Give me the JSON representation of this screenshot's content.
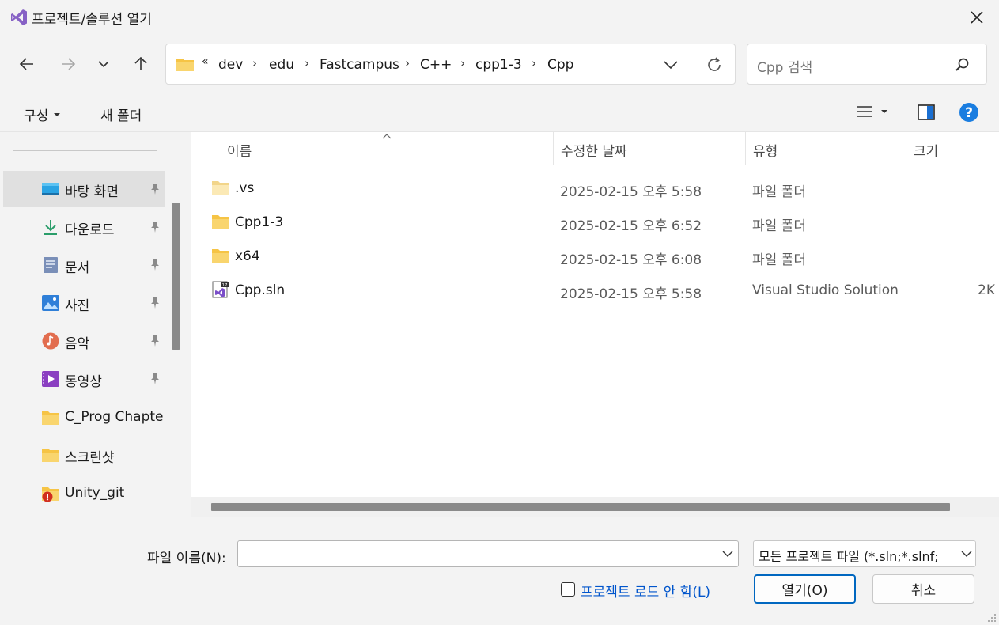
{
  "title": "프로젝트/솔루션 열기",
  "nav": {
    "breadcrumb_overflow": "«",
    "breadcrumb": [
      "dev",
      "edu",
      "Fastcampus",
      "C++",
      "cpp1-3",
      "Cpp"
    ],
    "search_placeholder": "Cpp 검색"
  },
  "toolbar": {
    "organize_label": "구성",
    "new_folder_label": "새 폴더"
  },
  "sidebar": {
    "items": [
      {
        "label": "바탕 화면",
        "icon": "desktop-icon",
        "pinned": true
      },
      {
        "label": "다운로드",
        "icon": "download-icon",
        "pinned": true
      },
      {
        "label": "문서",
        "icon": "document-icon",
        "pinned": true
      },
      {
        "label": "사진",
        "icon": "pictures-icon",
        "pinned": true
      },
      {
        "label": "음악",
        "icon": "music-icon",
        "pinned": true
      },
      {
        "label": "동영상",
        "icon": "video-icon",
        "pinned": true
      },
      {
        "label": "C_Prog Chapter_",
        "icon": "folder-icon",
        "pinned": false
      },
      {
        "label": "스크린샷",
        "icon": "folder-icon",
        "pinned": false
      },
      {
        "label": "Unity_git",
        "icon": "folder-warning-icon",
        "pinned": false
      }
    ]
  },
  "columns": {
    "name": "이름",
    "date": "수정한 날짜",
    "type": "유형",
    "size": "크기"
  },
  "files": [
    {
      "name": ".vs",
      "date": "2025-02-15 오후 5:58",
      "type": "파일 폴더",
      "size": "",
      "icon": "folder-icon"
    },
    {
      "name": "Cpp1-3",
      "date": "2025-02-15 오후 6:52",
      "type": "파일 폴더",
      "size": "",
      "icon": "folder-icon"
    },
    {
      "name": "x64",
      "date": "2025-02-15 오후 6:08",
      "type": "파일 폴더",
      "size": "",
      "icon": "folder-icon"
    },
    {
      "name": "Cpp.sln",
      "date": "2025-02-15 오후 5:58",
      "type": "Visual Studio Solution",
      "size": "2K",
      "icon": "vs-solution-icon"
    }
  ],
  "bottom": {
    "filename_label": "파일 이름(N):",
    "filename_value": "",
    "filter_value": "모든 프로젝트 파일 (*.sln;*.slnf;",
    "no_load_label": "프로젝트 로드 안 함(L)",
    "open_label": "열기(O)",
    "cancel_label": "취소"
  },
  "colors": {
    "accent": "#0067c0",
    "folder": "#f6c445",
    "vs_purple": "#7a4ec9",
    "help_blue": "#1a7de0"
  }
}
